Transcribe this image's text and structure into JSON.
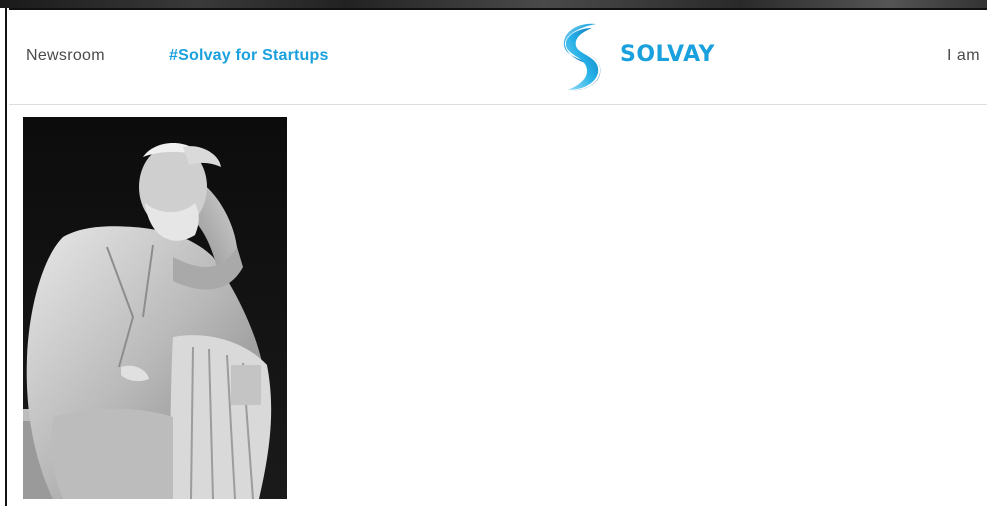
{
  "header": {
    "nav": {
      "newsroom_label": "Newsroom",
      "startups_label": "#Solvay for Startups",
      "iam_label": "I am"
    },
    "logo": {
      "wordmark": "SOLVAY",
      "icon": "solvay-s-logo-icon"
    }
  },
  "content": {
    "image": {
      "subject": "statue-photo"
    }
  },
  "colors": {
    "brand_blue": "#1aa1dd",
    "nav_text": "#4a4a4a",
    "divider": "#dedede"
  }
}
